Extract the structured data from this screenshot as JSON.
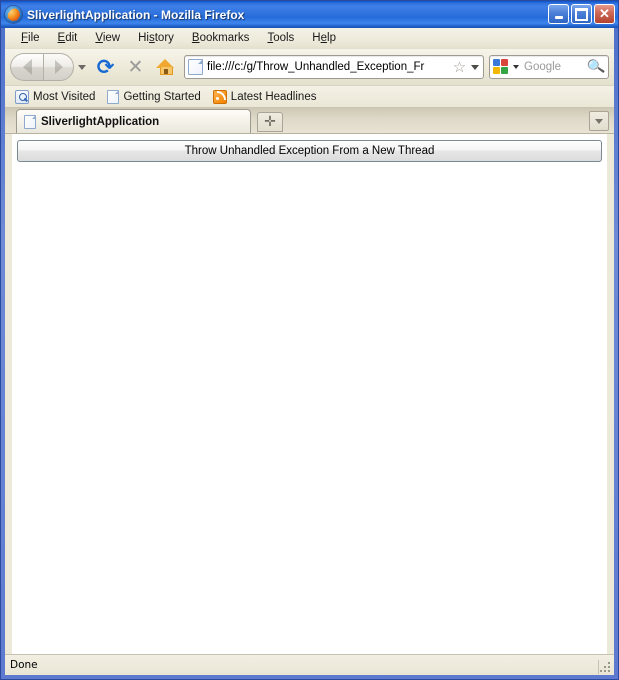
{
  "window": {
    "title": "SliverlightApplication - Mozilla Firefox",
    "logo_icon": "firefox-logo-icon",
    "controls": {
      "minimize": "minimize-icon",
      "maximize": "maximize-icon",
      "close": "✕"
    }
  },
  "menubar": {
    "items": [
      {
        "label": "File",
        "accesskey": "F"
      },
      {
        "label": "Edit",
        "accesskey": "E"
      },
      {
        "label": "View",
        "accesskey": "V"
      },
      {
        "label": "History",
        "accesskey": "s"
      },
      {
        "label": "Bookmarks",
        "accesskey": "B"
      },
      {
        "label": "Tools",
        "accesskey": "T"
      },
      {
        "label": "Help",
        "accesskey": "e"
      }
    ]
  },
  "toolbar": {
    "back_icon": "back-arrow-icon",
    "forward_icon": "forward-arrow-icon",
    "history_dropdown_icon": "chevron-down-icon",
    "reload_icon": "⟳",
    "stop_icon": "✕",
    "home_icon": "home-icon",
    "back_enabled": false,
    "forward_enabled": false,
    "stop_enabled": false
  },
  "urlbar": {
    "favicon": "page-icon",
    "value": "file:///c:/g/Throw_Unhandled_Exception_Fr",
    "bookmark_star_icon": "☆",
    "dropdown_icon": "chevron-down-icon"
  },
  "searchbar": {
    "engine_icon": "google-icon",
    "engine_dropdown_icon": "chevron-down-icon",
    "placeholder": "Google",
    "search_icon": "magnifier-icon"
  },
  "bookmarks": {
    "items": [
      {
        "label": "Most Visited",
        "icon": "most-visited-icon"
      },
      {
        "label": "Getting Started",
        "icon": "page-icon"
      },
      {
        "label": "Latest Headlines",
        "icon": "rss-icon"
      }
    ]
  },
  "tabs": {
    "items": [
      {
        "label": "SliverlightApplication",
        "icon": "page-icon",
        "active": true
      }
    ],
    "new_tab_label": "✛",
    "list_all_tabs_icon": "chevron-down-icon"
  },
  "content": {
    "button_label": "Throw Unhandled Exception From a New Thread"
  },
  "statusbar": {
    "text": "Done",
    "resize_grip_icon": "resize-grip-icon"
  }
}
